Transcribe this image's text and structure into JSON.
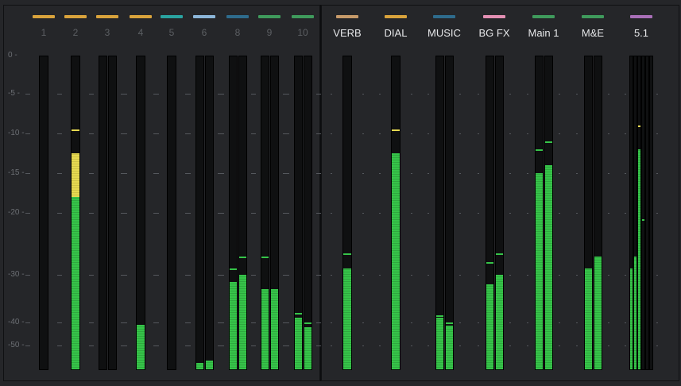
{
  "scale": {
    "labels": [
      "0 -",
      "-5 -",
      "-10 -",
      "-15 -",
      "-20 -",
      "-30 -",
      "-40 -",
      "-50 -"
    ],
    "db_values": [
      0,
      -5,
      -10,
      -15,
      -20,
      -30,
      -40,
      -50
    ]
  },
  "tracks": [
    {
      "label": "1",
      "color": "#d9a33c",
      "channels": [
        {
          "level_db": null,
          "peak_db": null
        }
      ]
    },
    {
      "label": "2",
      "color": "#d9a33c",
      "channels": [
        {
          "level_db": -12.5,
          "peak_db": -9.5,
          "yellow_to_db": -18
        }
      ]
    },
    {
      "label": "3",
      "color": "#d9a33c",
      "channels": [
        {
          "level_db": null,
          "peak_db": null
        },
        {
          "level_db": null,
          "peak_db": null
        }
      ]
    },
    {
      "label": "4",
      "color": "#d9a33c",
      "channels": [
        {
          "level_db": -41.5,
          "peak_db": -41
        }
      ]
    },
    {
      "label": "5",
      "color": "#2aa3a0",
      "channels": [
        {
          "level_db": -60,
          "peak_db": null
        }
      ]
    },
    {
      "label": "6",
      "color": "#8cb6d9",
      "channels": [
        {
          "level_db": -57,
          "peak_db": null
        },
        {
          "level_db": -56,
          "peak_db": null
        }
      ]
    },
    {
      "label": "8",
      "color": "#2e6b8c",
      "channels": [
        {
          "level_db": -31.5,
          "peak_db": -29
        },
        {
          "level_db": -30,
          "peak_db": -27
        }
      ]
    },
    {
      "label": "9",
      "color": "#3f9a5c",
      "channels": [
        {
          "level_db": -33,
          "peak_db": -27
        },
        {
          "level_db": -33,
          "peak_db": null
        }
      ]
    },
    {
      "label": "10",
      "color": "#3f9a5c",
      "channels": [
        {
          "level_db": -39,
          "peak_db": -38
        },
        {
          "level_db": -42,
          "peak_db": -40
        }
      ]
    }
  ],
  "buses": [
    {
      "label": "VERB",
      "color": "#c69a6a",
      "channels": [
        {
          "level_db": -29,
          "peak_db": -26.5
        }
      ]
    },
    {
      "label": "DIAL",
      "color": "#d9a33c",
      "channels": [
        {
          "level_db": -12.5,
          "peak_db": -9.5
        }
      ]
    },
    {
      "label": "MUSIC",
      "color": "#2e6b8c",
      "channels": [
        {
          "level_db": -39,
          "peak_db": -38.5
        },
        {
          "level_db": -41.5,
          "peak_db": -40
        }
      ]
    },
    {
      "label": "BG FX",
      "color": "#e38fb3",
      "channels": [
        {
          "level_db": -32,
          "peak_db": -28
        },
        {
          "level_db": -30,
          "peak_db": -26.5
        }
      ]
    },
    {
      "label": "Main 1",
      "color": "#3f9a5c",
      "channels": [
        {
          "level_db": -15,
          "peak_db": -12
        },
        {
          "level_db": -14,
          "peak_db": -11
        }
      ]
    },
    {
      "label": "M&E",
      "color": "#3f9a5c",
      "channels": [
        {
          "level_db": -29,
          "peak_db": null
        },
        {
          "level_db": -27,
          "peak_db": null
        }
      ]
    },
    {
      "label": "5.1",
      "color": "#a96fb8",
      "channels": [
        {
          "level_db": -29,
          "peak_db": null
        },
        {
          "level_db": -27,
          "peak_db": -28
        },
        {
          "level_db": -12,
          "peak_db": -9
        },
        {
          "level_db": null,
          "peak_db": -21
        },
        {
          "level_db": null,
          "peak_db": null
        },
        {
          "level_db": null,
          "peak_db": null
        }
      ]
    }
  ]
}
